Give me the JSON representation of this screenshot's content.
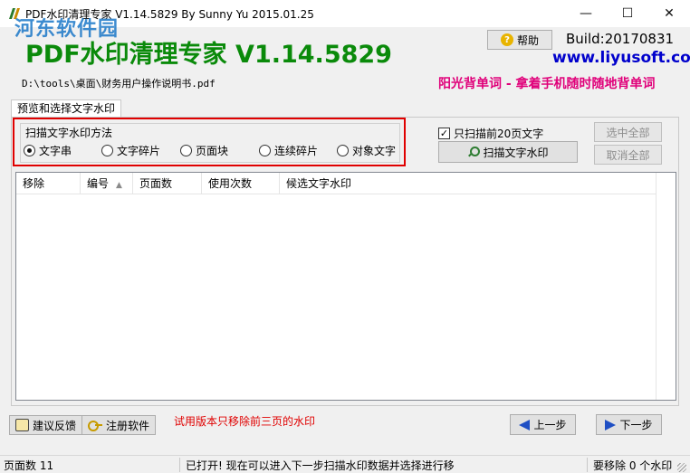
{
  "window": {
    "title": "PDF水印清理专家 V1.14.5829 By Sunny Yu 2015.01.25",
    "watermark_logo": "河东软件园",
    "minimize": "—",
    "maximize": "☐",
    "close": "✕"
  },
  "header": {
    "app_title": "PDF水印清理专家 V1.14.5829",
    "help_label": "帮助",
    "help_icon": "?",
    "build": "Build:20170831",
    "website": "www.liyusoft.com",
    "file_path": "D:\\tools\\桌面\\财务用户操作说明书.pdf",
    "promo": "阳光背单词 - 拿着手机随时随地背单词"
  },
  "tab": {
    "label": "预览和选择文字水印"
  },
  "scan_method": {
    "title": "扫描文字水印方法",
    "options": [
      {
        "label": "文字串",
        "selected": true
      },
      {
        "label": "文字碎片",
        "selected": false
      },
      {
        "label": "页面块",
        "selected": false
      },
      {
        "label": "连续碎片",
        "selected": false
      },
      {
        "label": "对象文字",
        "selected": false
      }
    ]
  },
  "controls": {
    "first20_label": "只扫描前20页文字",
    "first20_checked": "✓",
    "scan_button": "扫描文字水印",
    "select_all": "选中全部",
    "deselect_all": "取消全部"
  },
  "table": {
    "columns": [
      "移除",
      "编号",
      "页面数",
      "使用次数",
      "候选文字水印"
    ],
    "sort_indicator": "▲",
    "rows": []
  },
  "footer": {
    "feedback": "建议反馈",
    "register": "注册软件",
    "trial_notice": "试用版本只移除前三页的水印",
    "prev": "上一步",
    "next": "下一步"
  },
  "status": {
    "pages": "页面数 11",
    "message": "已打开! 现在可以进入下一步扫描水印数据并选择进行移",
    "remove_count": "要移除 0 个水印"
  }
}
